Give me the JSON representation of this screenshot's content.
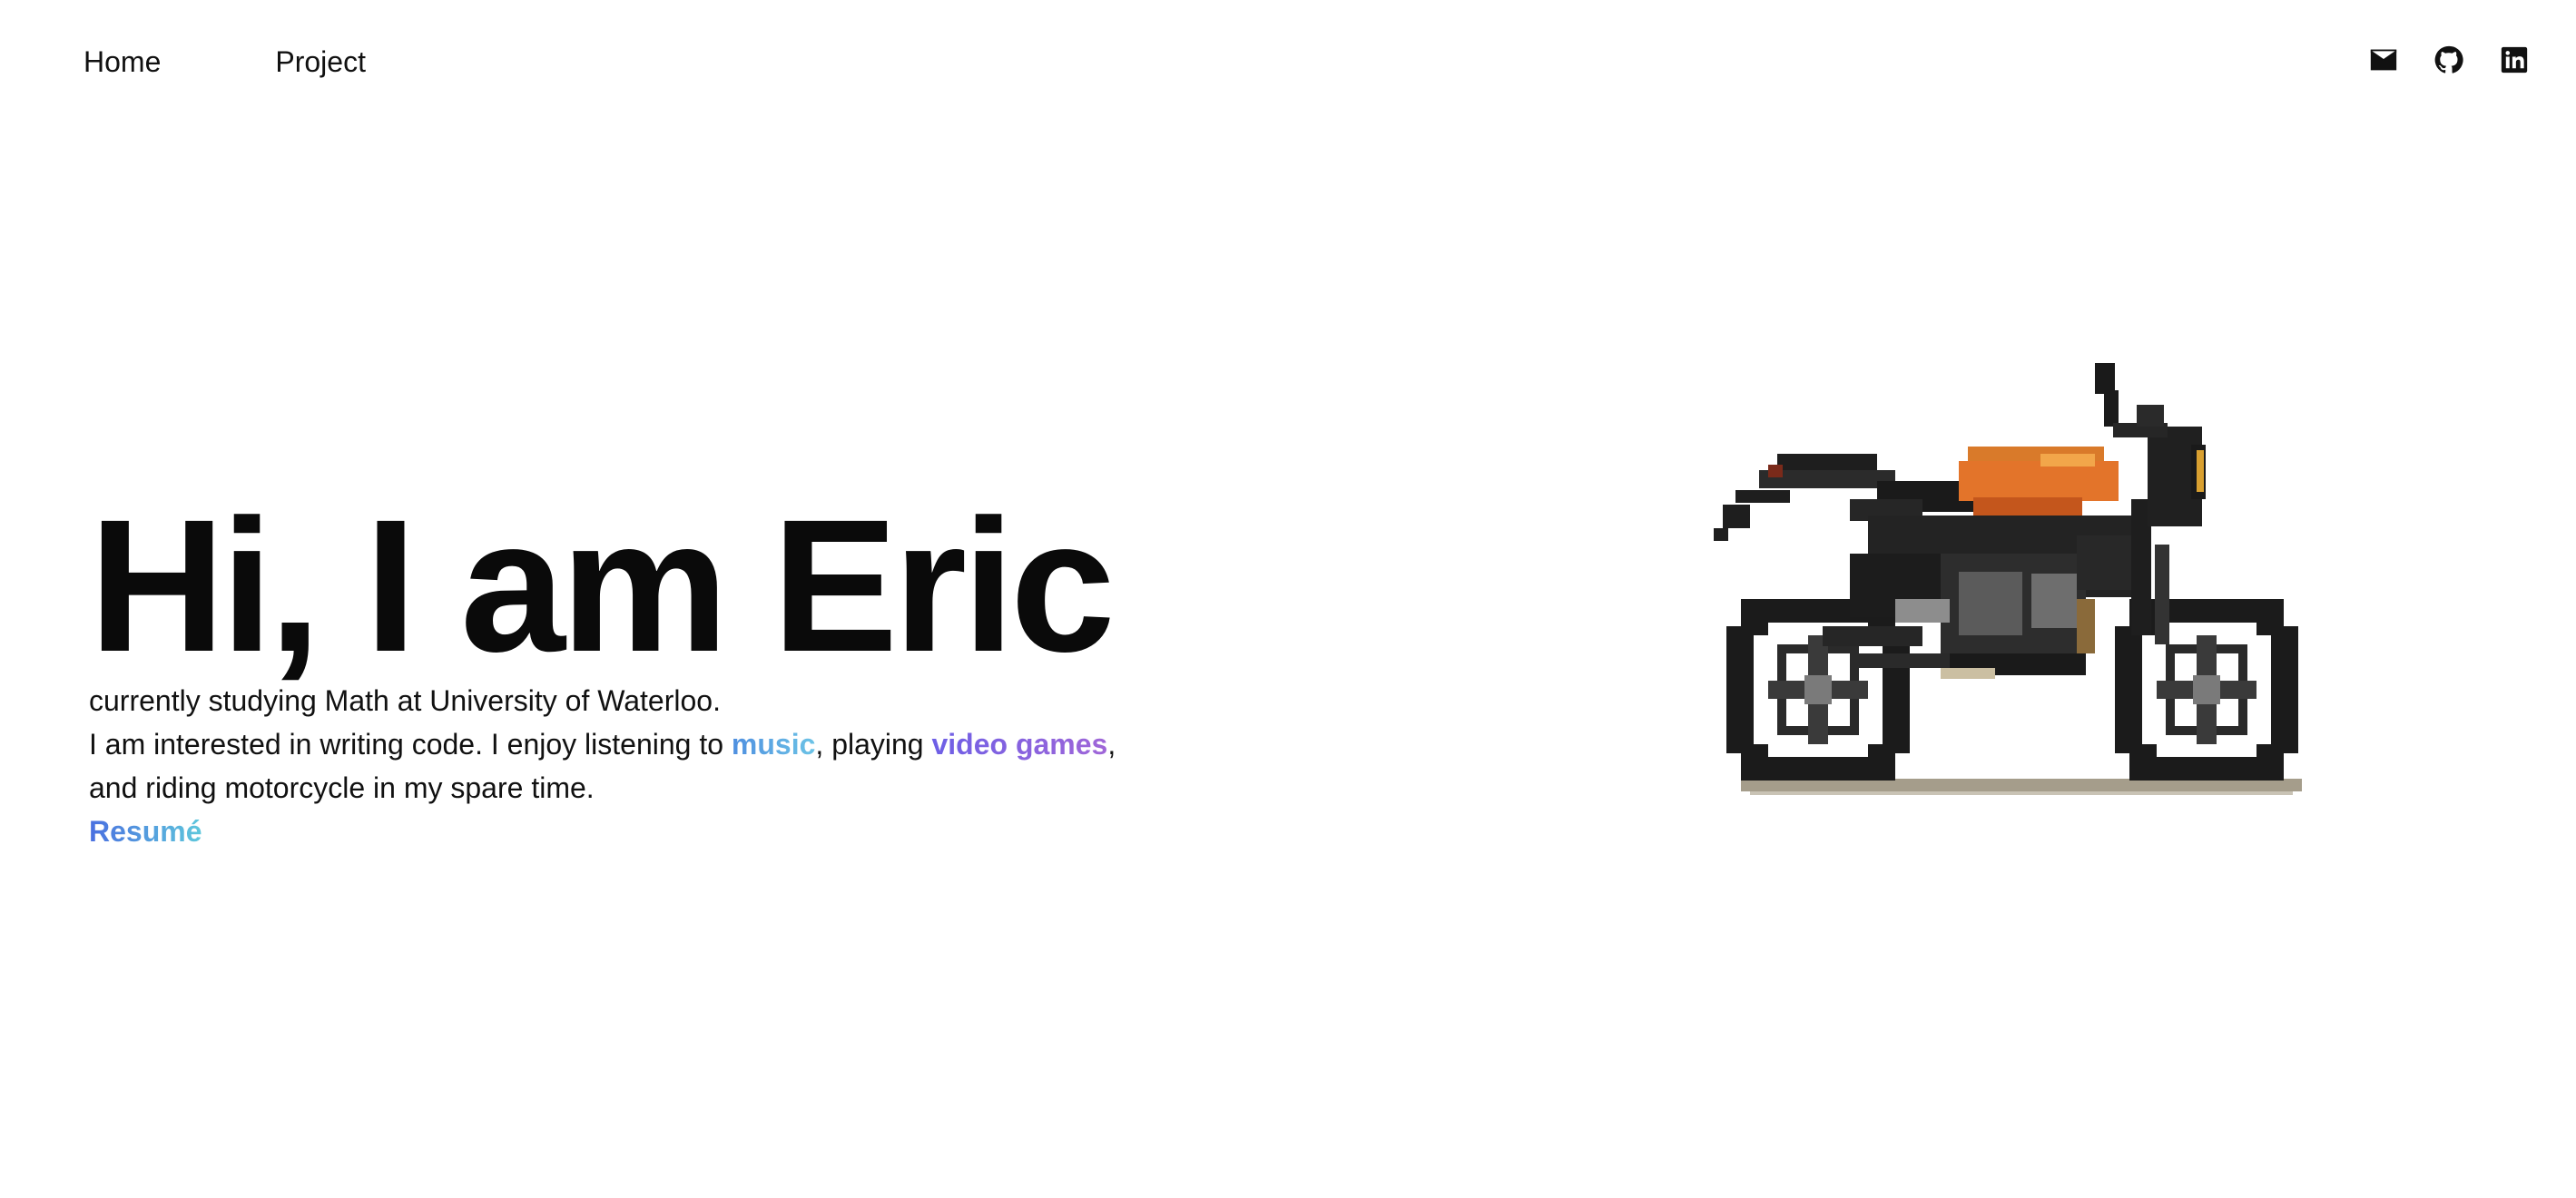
{
  "nav": {
    "links": [
      {
        "label": "Home"
      },
      {
        "label": "Project"
      }
    ],
    "social": [
      {
        "icon": "mail-icon"
      },
      {
        "icon": "github-icon"
      },
      {
        "icon": "linkedin-icon"
      }
    ]
  },
  "hero": {
    "title": "Hi, I am Eric",
    "line1": "currently studying Math at University of Waterloo.",
    "line2_prefix": "I am interested in writing code. I enjoy listening to ",
    "music_link": "music",
    "line2_middle": ", playing ",
    "games_link": "video games",
    "line2_suffix": ",",
    "line3": "and riding motorcycle in my spare time.",
    "resume_link": "Resumé"
  },
  "colors": {
    "text": "#111111",
    "music_gradient": [
      "#4f8fe0",
      "#6cc3e6"
    ],
    "games_gradient": [
      "#6d5fe6",
      "#a066d8"
    ],
    "resume_gradient": [
      "#4a6fe0",
      "#5ec8dc"
    ],
    "tank_orange": "#e3742a"
  }
}
